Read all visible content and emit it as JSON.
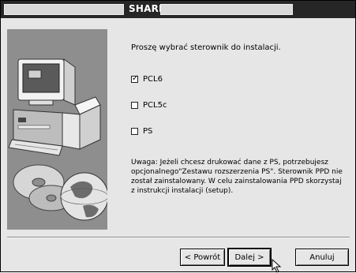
{
  "window": {
    "title": "SHARP"
  },
  "main": {
    "prompt": "Proszę wybrać sterownik do instalacji.",
    "options": [
      {
        "label": "PCL6",
        "checked": true
      },
      {
        "label": "PCL5c",
        "checked": false
      },
      {
        "label": "PS",
        "checked": false
      }
    ],
    "note_lines": [
      "Uwaga: Jeżeli chcesz drukować dane z PS, potrzebujesz",
      "opcjonalnego\"Zestawu rozszerzenia PS\". Sterownik PPD nie",
      "został zainstalowany. W celu zainstalowania PPD skorzystaj",
      "z instrukcji instalacji (setup)."
    ]
  },
  "buttons": {
    "back": "< Powrót",
    "next": "Dalej >",
    "cancel": "Anuluj"
  },
  "icons": {
    "check": "check-icon",
    "illustration": "computer-illustration",
    "cursor": "mouse-cursor-icon"
  },
  "colors": {
    "titlebar": "#262626",
    "dialog_bg": "#e6e6e6",
    "illustration_bg": "#8e8e8e"
  }
}
